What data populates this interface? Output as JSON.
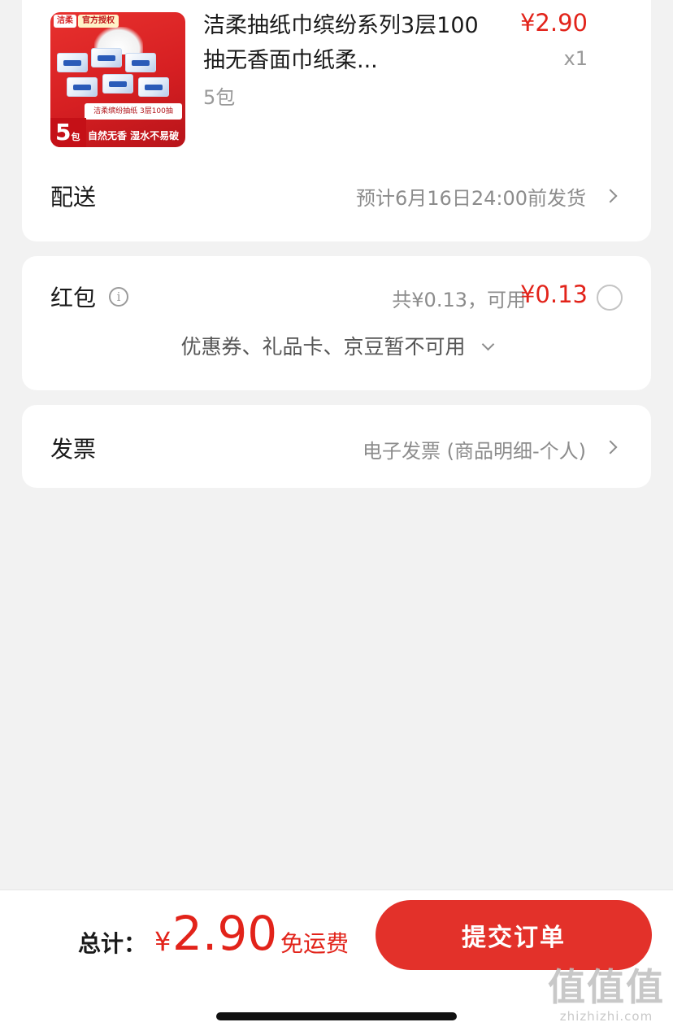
{
  "product": {
    "thumbnail": {
      "brand": "洁柔",
      "auth_tag": "官方授权",
      "info": "洁柔缤纷抽纸 3层100抽",
      "pack_count": "5",
      "pack_unit": "包",
      "slogan": "自然无香 湿水不易破"
    },
    "title": "洁柔抽纸巾缤纷系列3层100抽无香面巾纸柔...",
    "spec": "5包",
    "price": "¥2.90",
    "quantity": "x1"
  },
  "delivery": {
    "label": "配送",
    "value": "预计6月16日24:00前发货"
  },
  "red_packet": {
    "label": "红包",
    "info_icon": "i",
    "total": "共¥0.13，可用",
    "available": "¥0.13",
    "note": "优惠券、礼品卡、京豆暂不可用"
  },
  "invoice": {
    "label": "发票",
    "value": "电子发票 (商品明细-个人)"
  },
  "footer": {
    "total_label": "总计：",
    "currency": "¥",
    "amount": "2.90",
    "shipping": "免运费",
    "submit_label": "提交订单"
  },
  "watermark": {
    "big": "值值值",
    "small": "zhizhizhi.com"
  },
  "colors": {
    "accent": "#e2231a",
    "button": "#e3312a",
    "background": "#f2f2f2",
    "muted": "#8c8c8c"
  }
}
